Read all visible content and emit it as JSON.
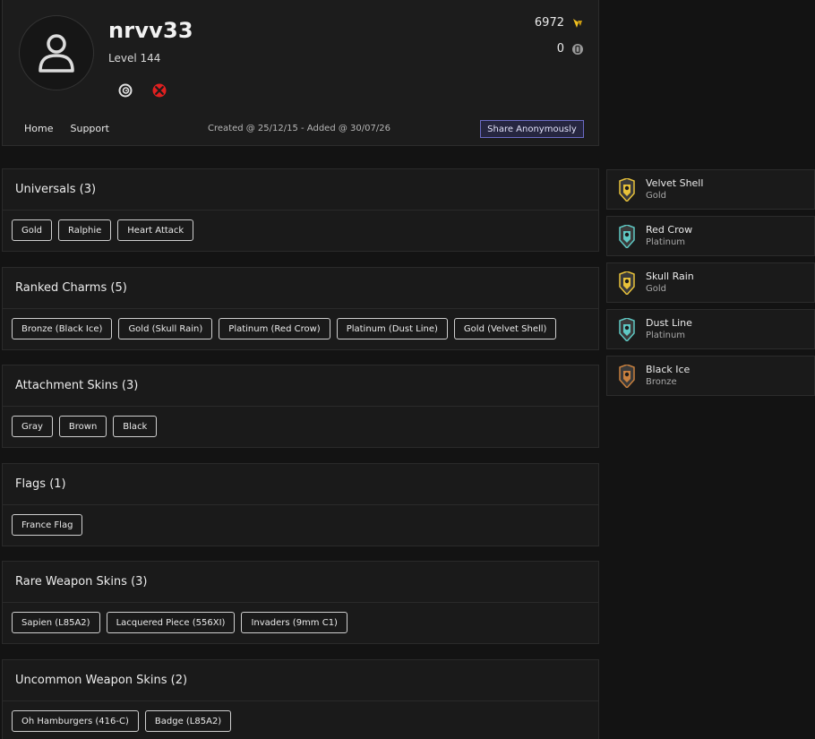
{
  "profile": {
    "username": "nrvv33",
    "level": "Level 144",
    "platforms": [
      {
        "name": "ubisoft-icon",
        "color": "#e0e0e0"
      },
      {
        "name": "xbox-icon",
        "color": "#e02020"
      }
    ],
    "credits": "6972",
    "credits_color": "#f0c020",
    "premium": "0",
    "nav": [
      "Home",
      "Support"
    ],
    "dates": "Created @ 25/12/15 - Added @ 30/07/26",
    "share_label": "Share Anonymously"
  },
  "sections": [
    {
      "title": "Universals (3)",
      "items": [
        "Gold",
        "Ralphie",
        "Heart Attack"
      ]
    },
    {
      "title": "Ranked Charms (5)",
      "items": [
        "Bronze (Black Ice)",
        "Gold (Skull Rain)",
        "Platinum (Red Crow)",
        "Platinum (Dust Line)",
        "Gold (Velvet Shell)"
      ]
    },
    {
      "title": "Attachment Skins (3)",
      "items": [
        "Gray",
        "Brown",
        "Black"
      ]
    },
    {
      "title": "Flags (1)",
      "items": [
        "France Flag"
      ]
    },
    {
      "title": "Rare Weapon Skins (3)",
      "items": [
        "Sapien (L85A2)",
        "Lacquered Piece (556XI)",
        "Invaders (9mm C1)"
      ]
    },
    {
      "title": "Uncommon Weapon Skins (2)",
      "items": [
        "Oh Hamburgers (416-C)",
        "Badge (L85A2)"
      ]
    }
  ],
  "charms": [
    {
      "name": "Velvet Shell",
      "tier": "Gold",
      "color": "#e8c23a"
    },
    {
      "name": "Red Crow",
      "tier": "Platinum",
      "color": "#5fc9c4"
    },
    {
      "name": "Skull Rain",
      "tier": "Gold",
      "color": "#e8c23a"
    },
    {
      "name": "Dust Line",
      "tier": "Platinum",
      "color": "#5fc9c4"
    },
    {
      "name": "Black Ice",
      "tier": "Bronze",
      "color": "#c8803e"
    }
  ]
}
